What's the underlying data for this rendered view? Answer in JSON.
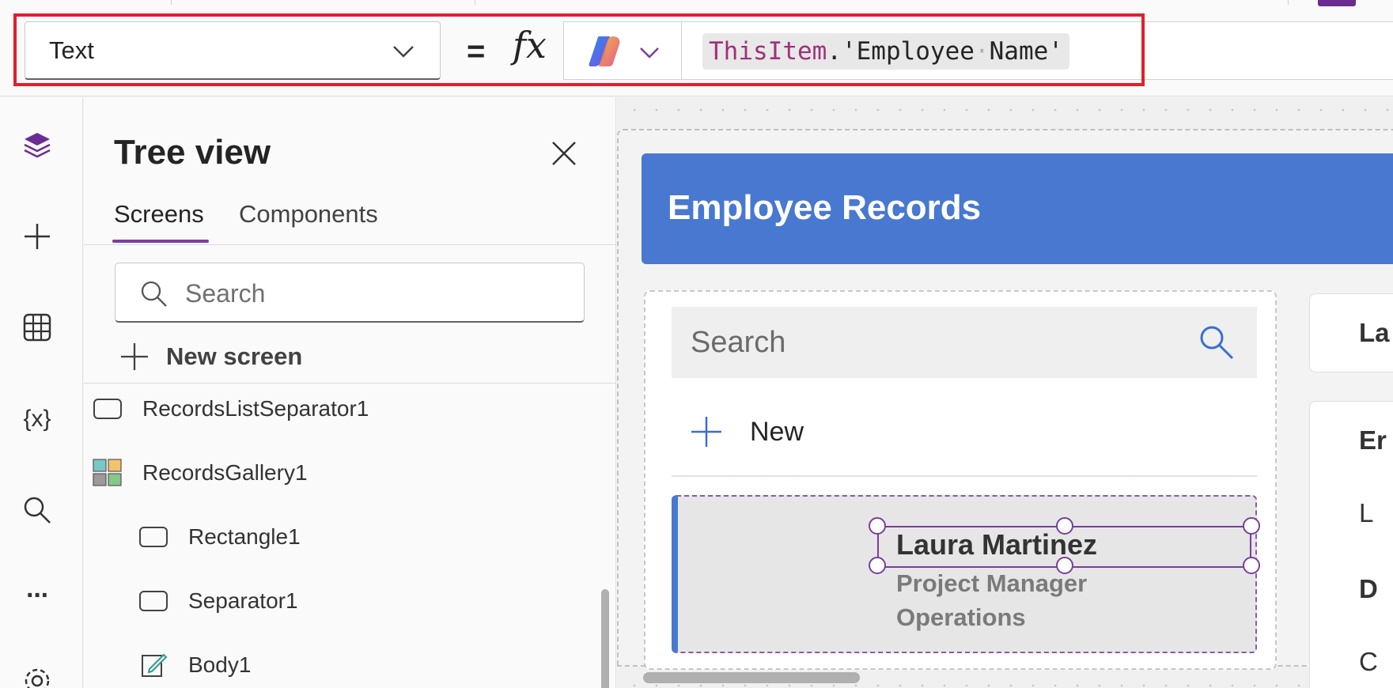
{
  "formula_bar": {
    "property": "Text",
    "equals": "=",
    "fx": "fx",
    "formula_keyword": "ThisItem",
    "formula_dot": ".",
    "formula_rest_a": "'Employee",
    "formula_space": "·",
    "formula_rest_b": "Name'"
  },
  "rail": {
    "icons": [
      "layers-icon",
      "insert-plus-icon",
      "data-table-icon",
      "variables-icon",
      "search-icon",
      "more-icon",
      "settings-icon"
    ],
    "variables_glyph": "{x}",
    "more_glyph": "···"
  },
  "tree_view": {
    "title": "Tree view",
    "tabs": [
      "Screens",
      "Components"
    ],
    "search_placeholder": "Search",
    "new_screen": "New screen",
    "nodes": [
      {
        "label": "RecordsListSeparator1",
        "icon": "rectangle-icon"
      },
      {
        "label": "RecordsGallery1",
        "icon": "gallery-icon"
      },
      {
        "label": "Rectangle1",
        "icon": "rectangle-icon"
      },
      {
        "label": "Separator1",
        "icon": "rectangle-icon"
      },
      {
        "label": "Body1",
        "icon": "edit-text-icon"
      }
    ]
  },
  "canvas": {
    "header_title": "Employee Records",
    "search_placeholder": "Search",
    "new_label": "New",
    "selected_item": {
      "name": "Laura Martinez",
      "title": "Project Manager",
      "department": "Operations"
    },
    "right_fragments": [
      "La",
      "Er",
      "L",
      "D",
      "C"
    ]
  },
  "colors": {
    "accent_purple": "#7a3f9c",
    "header_blue": "#4878d0",
    "highlight_red": "#e0202f"
  }
}
